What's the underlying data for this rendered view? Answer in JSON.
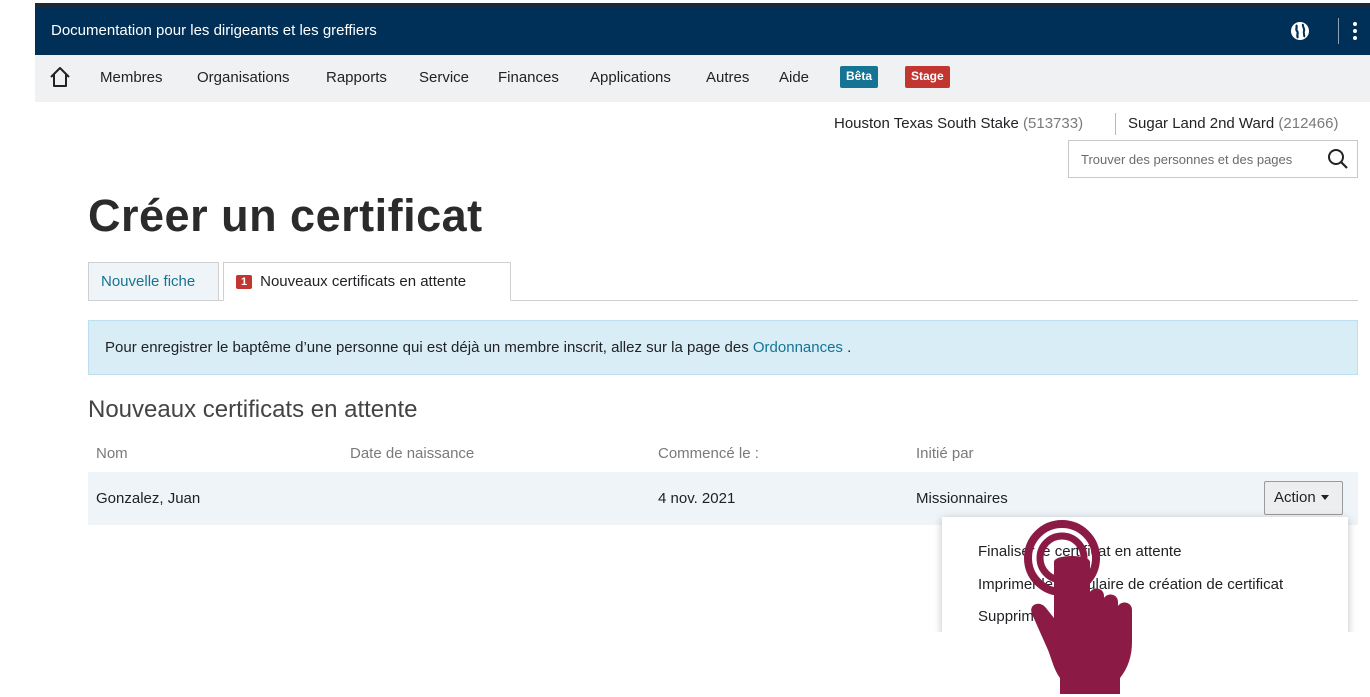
{
  "app": {
    "title": "Documentation pour les dirigeants et les greffiers"
  },
  "icons": {
    "globe": "globe-icon",
    "more": "vertical-dots-icon",
    "home": "home-icon",
    "search": "search-icon",
    "hand": "tap-hand-icon"
  },
  "colors": {
    "header": "#003057",
    "accent": "#157493",
    "alert": "#c23631",
    "hand": "#8b1a45"
  },
  "nav": {
    "items": [
      "Membres",
      "Organisations",
      "Rapports",
      "Service",
      "Finances",
      "Applications",
      "Autres",
      "Aide"
    ],
    "badge_beta": "Bêta",
    "badge_stage": "Stage"
  },
  "unit": {
    "stake_name": "Houston Texas South Stake",
    "stake_number": "(513733)",
    "ward_name": "Sugar Land 2nd Ward",
    "ward_number": "(212466)"
  },
  "search": {
    "placeholder": "Trouver des personnes et des pages"
  },
  "page": {
    "title": "Créer un certificat"
  },
  "tabs": {
    "new_record": "Nouvelle fiche",
    "pending_count": "1",
    "pending": "Nouveaux certificats en attente"
  },
  "alert": {
    "text_before": "Pour enregistrer le baptême d’une personne qui est déjà un membre inscrit, allez sur la page des ",
    "link": "Ordonnances",
    "text_after": " ."
  },
  "table": {
    "title": "Nouveaux certificats en attente",
    "headers": [
      "Nom",
      "Date de naissance",
      "Commencé le :",
      "Initié par"
    ],
    "rows": [
      {
        "name": "Gonzalez, Juan",
        "birth_date": "",
        "started": "4 nov. 2021",
        "initiated_by": "Missionnaires"
      }
    ],
    "action_label": "Action"
  },
  "dropdown": {
    "items": [
      "Finaliser le certificat en attente",
      "Imprimer le formulaire de création de certificat",
      "Supprimer"
    ]
  }
}
